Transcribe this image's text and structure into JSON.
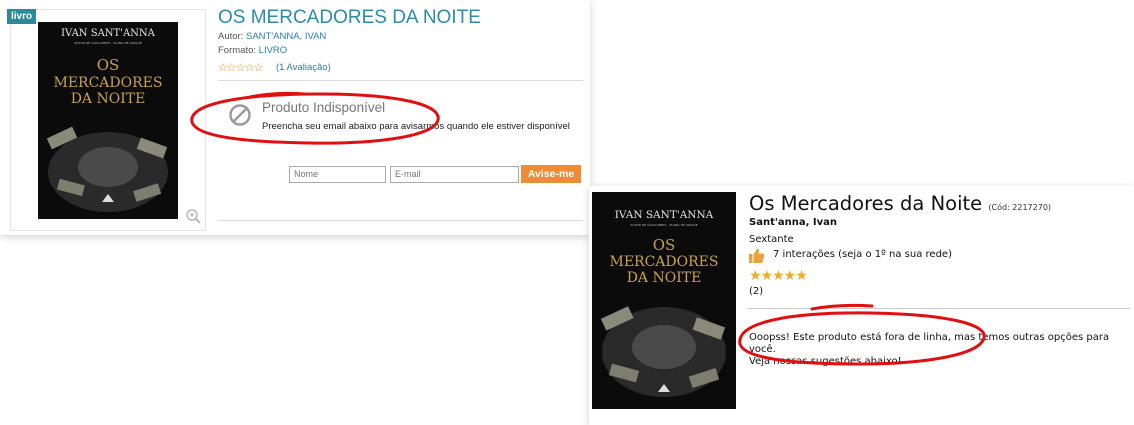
{
  "panel1": {
    "tag": "livro",
    "title": "OS MERCADORES DA NOITE",
    "author_label": "Autor: ",
    "author": "SANT'ANNA, IVAN",
    "format_label": "Formato: ",
    "format": "LIVRO",
    "rating_stars": "☆☆☆☆☆",
    "rating_text": "(1 Avaliação)",
    "unavailable": "Produto Indisponível",
    "notify": "Preencha seu email abaixo para avisarmos quando ele estiver disponível",
    "name_placeholder": "Nome",
    "email_placeholder": "E-mail",
    "button": "Avise-me"
  },
  "panel2": {
    "title": "Os Mercadores da Noite",
    "code": "(Cód: 2217270)",
    "author": "Sant'anna, Ivan",
    "publisher": "Sextante",
    "interactions": "7 interações (seja o 1º na sua rede)",
    "stars": "★★★★★",
    "rating_count": "(2)",
    "message_line1": "Ooopss! Este produto está fora de linha, mas temos outras opções para você.",
    "message_line2": "Veja nossas sugestões abaixo!"
  },
  "cover": {
    "author": "IVAN SANT'ANNA",
    "tagline": "AUTOR DE CAIXA-PRETA · PLANO DE ATAQUE",
    "title_line1": "OS",
    "title_line2": "MERCADORES",
    "title_line3": "DA NOITE"
  },
  "colors": {
    "brand_teal": "#2b8ca8",
    "button_orange": "#ef8b35",
    "star_gold": "#f0ad2a",
    "annotation_red": "#e01010"
  }
}
